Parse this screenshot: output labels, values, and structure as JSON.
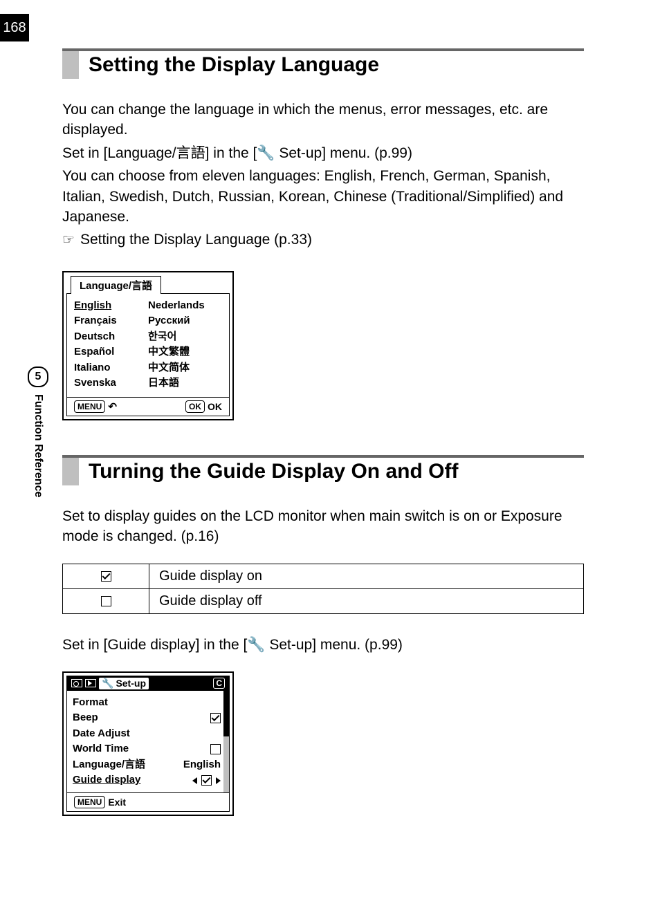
{
  "page_number": "168",
  "chapter": {
    "number": "5",
    "label": "Function Reference"
  },
  "sec1": {
    "heading": "Setting the Display Language",
    "p1": "You can change the language in which the menus, error messages, etc. are displayed.",
    "p2a": "Set in [Language/",
    "p2b": "言語",
    "p2c": "] in the [",
    "p2d": " Set-up] menu. (p.99)",
    "p3": "You can choose from eleven languages: English, French, German, Spanish, Italian, Swedish, Dutch, Russian, Korean, Chinese (Traditional/Simplified) and Japanese.",
    "p4": "Setting the Display Language (p.33)",
    "lcd": {
      "title": "Language/言語",
      "col1": [
        "English",
        "Français",
        "Deutsch",
        "Español",
        "Italiano",
        "Svenska"
      ],
      "col2": [
        "Nederlands",
        "Русский",
        "한국어",
        "中文繁體",
        "中文简体",
        "日本語"
      ],
      "menu_label": "MENU",
      "ok_box": "OK",
      "ok_label": "OK"
    }
  },
  "sec2": {
    "heading": "Turning the Guide Display On and Off",
    "p1": "Set to display guides on the LCD monitor when main switch is on or Exposure mode is changed. (p.16)",
    "table": {
      "row1": "Guide display on",
      "row2": "Guide display off"
    },
    "p2a": "Set in [Guide display] in the [",
    "p2b": " Set-up] menu. (p.99)",
    "lcd": {
      "header_label": "Set-up",
      "c_label": "C",
      "rows": {
        "format": "Format",
        "beep": "Beep",
        "date_adjust": "Date Adjust",
        "world_time": "World Time",
        "language": "Language/言語",
        "language_val": "English",
        "guide_display": "Guide display"
      },
      "menu_label": "MENU",
      "exit_label": "Exit"
    }
  }
}
